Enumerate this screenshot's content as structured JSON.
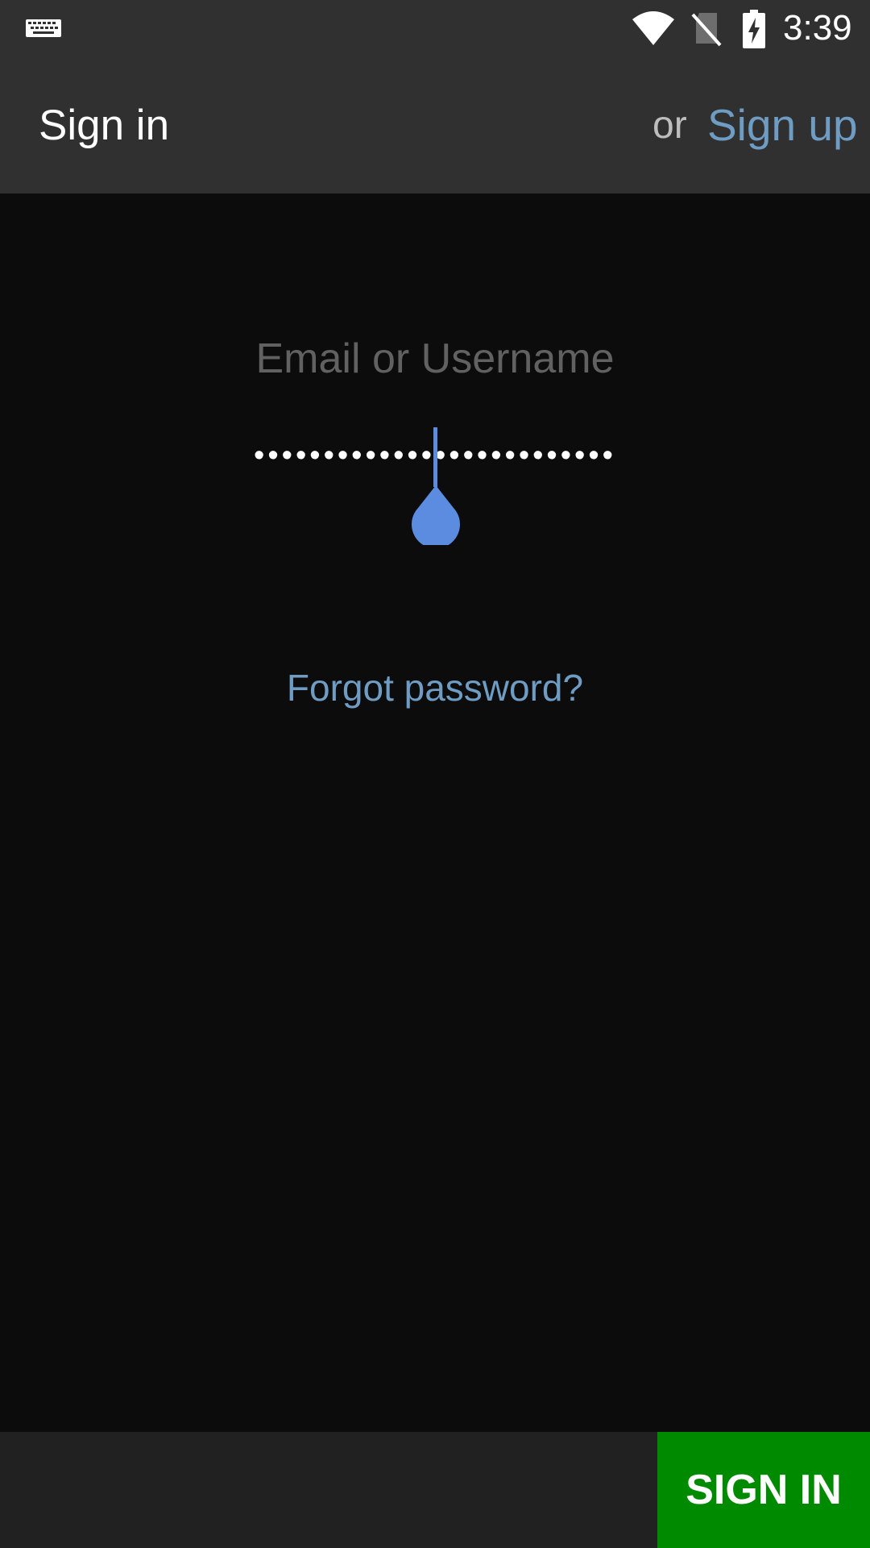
{
  "status_bar": {
    "time": "3:39",
    "icons": [
      "keyboard-icon",
      "wifi-icon",
      "no-sim-icon",
      "battery-charging-icon"
    ]
  },
  "app_bar": {
    "title": "Sign in",
    "or_text": "or",
    "signup_label": "Sign up"
  },
  "form": {
    "username_placeholder": "Email or Username",
    "username_value": "",
    "password_value": "••••••••••••••••••••••••••"
  },
  "links": {
    "forgot_password": "Forgot password?"
  },
  "bottom_bar": {
    "signin_label": "SIGN IN"
  },
  "colors": {
    "bar_background": "#303030",
    "page_background": "#0c0c0c",
    "link": "#6f9cc3",
    "cursor": "#5b8cdf",
    "signin_button": "#008a00"
  }
}
